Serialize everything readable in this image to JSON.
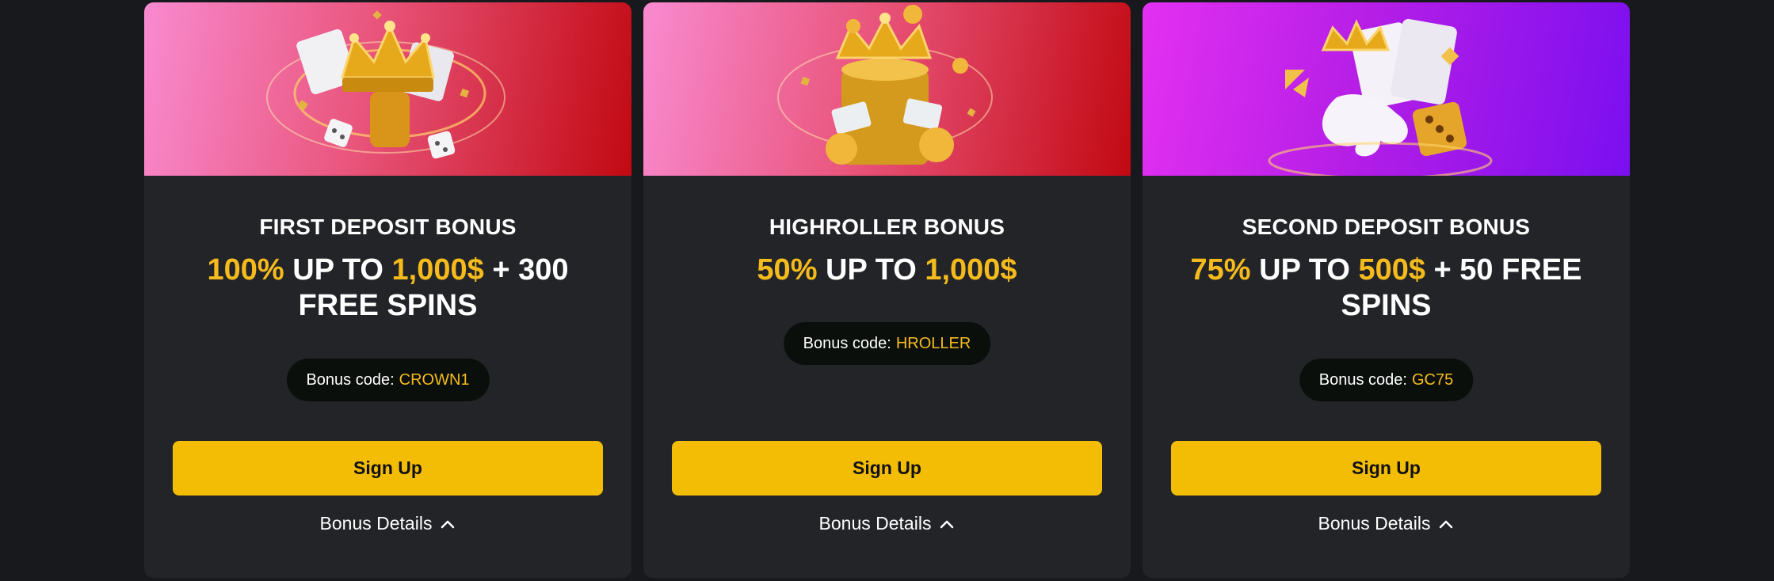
{
  "cards": [
    {
      "title": "FIRST DEPOSIT BONUS",
      "offer": {
        "pct": "100%",
        "upto": " UP TO ",
        "amount": "1,000$",
        "extra": " + 300 FREE SPINS"
      },
      "code_label": "Bonus code:",
      "code": "CROWN1",
      "signup": "Sign Up",
      "details": "Bonus Details"
    },
    {
      "title": "HIGHROLLER BONUS",
      "offer": {
        "pct": "50%",
        "upto": " UP TO ",
        "amount": "1,000$",
        "extra": ""
      },
      "code_label": "Bonus code:",
      "code": "HROLLER",
      "signup": "Sign Up",
      "details": "Bonus Details"
    },
    {
      "title": "SECOND DEPOSIT BONUS",
      "offer": {
        "pct": "75%",
        "upto": " UP TO ",
        "amount": "500$",
        "extra": " + 50 FREE SPINS"
      },
      "code_label": "Bonus code:",
      "code": "GC75",
      "signup": "Sign Up",
      "details": "Bonus Details"
    }
  ],
  "colors": {
    "accent": "#f5bb1c",
    "button": "#f3bd05",
    "card_bg": "#232428",
    "page_bg": "#18191c",
    "pill_bg": "#0b0f0c"
  },
  "icons": [
    "crown-image",
    "coins-image",
    "cards-dice-image",
    "chevron-up-icon"
  ]
}
